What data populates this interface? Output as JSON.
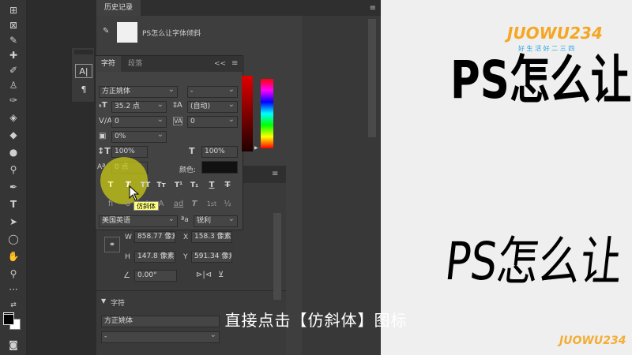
{
  "history_panel": {
    "tab_label": "历史记录",
    "entry_label": "PS怎么让字体倾斜"
  },
  "character_panel": {
    "tabs": [
      "字符",
      "段落"
    ],
    "collapse_label": "<<",
    "font_family": "方正姚体",
    "font_style": "-",
    "font_size": "35.2 点",
    "leading": "(自动)",
    "kerning": "0",
    "tracking": "0",
    "tsume": "0%",
    "vertical_scale": "100%",
    "horizontal_scale": "100%",
    "baseline_shift": "0 点",
    "color_label": "颜色:",
    "style_buttons": [
      "T",
      "T",
      "TT",
      "Tт",
      "T¹",
      "T₁",
      "T",
      "T"
    ],
    "opentype_buttons": [
      "fi",
      "σ",
      "st",
      "A",
      "ad",
      "T",
      "1st",
      "½"
    ],
    "tooltip": "仿斜体",
    "language": "美国英语",
    "aa_icon": "ªa",
    "anti_alias": "锐利"
  },
  "properties_panel": {
    "w_label": "W",
    "w_value": "858.77 像素",
    "x_label": "X",
    "x_value": "158.3 像素",
    "h_label": "H",
    "h_value": "147.8 像素",
    "y_label": "Y",
    "y_value": "591.34 像素",
    "angle_value": "0.00°",
    "section_label": "字符",
    "font_family": "方正姚体",
    "font_style": "-"
  },
  "canvas": {
    "text_line_1": "PS怎么让",
    "text_line_2": "PS怎么让",
    "logo_text": "JUOWU234",
    "logo_subtitle": "好 生 活 好 二 三 四",
    "watermark_text": "JUOWU234"
  },
  "subtitle": "直接点击【仿斜体】图标",
  "colors": {
    "ps_dark": "#3e3e3e",
    "highlight": "#c8c814",
    "tooltip_bg": "#ffff80",
    "logo_orange": "#f5a623",
    "logo_green": "#5fbf4a",
    "logo_blue": "#2aa7e0"
  }
}
